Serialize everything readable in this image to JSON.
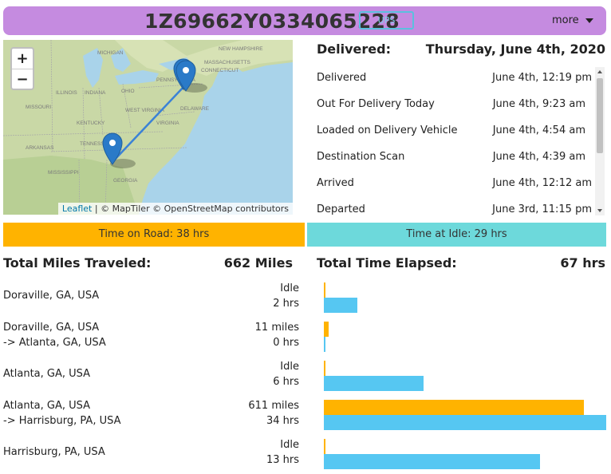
{
  "header": {
    "tracking_number": "1Z69662Y0334065228",
    "carrier": "UPS",
    "more_label": "more"
  },
  "map": {
    "zoom_in": "+",
    "zoom_out": "−",
    "attribution_leaflet": "Leaflet",
    "attribution_sep": "|",
    "attribution_rest": "© MapTiler © OpenStreetMap contributors",
    "labels": [
      "MASSACHUSETTS",
      "NEW HAMPSHIRE",
      "PENNSYLVANIA",
      "CONNECTICUT",
      "MICHIGAN",
      "ILLINOIS",
      "INDIANA",
      "OHIO",
      "MISSOURI",
      "WEST VIRGINIA",
      "VIRGINIA",
      "DELAWARE",
      "KENTUCKY",
      "ARKANSAS",
      "TENNESSEE",
      "MISSISSIPPI",
      "GEORGIA"
    ]
  },
  "events": {
    "status_label": "Delivered:",
    "status_date": "Thursday, June 4th, 2020",
    "items": [
      {
        "event": "Delivered",
        "time": "June 4th, 12:19 pm"
      },
      {
        "event": "Out For Delivery Today",
        "time": "June 4th, 9:23 am"
      },
      {
        "event": "Loaded on Delivery Vehicle",
        "time": "June 4th, 4:54 am"
      },
      {
        "event": "Destination Scan",
        "time": "June 4th, 4:39 am"
      },
      {
        "event": "Arrived",
        "time": "June 4th, 12:12 am"
      },
      {
        "event": "Departed",
        "time": "June 3rd, 11:15 pm"
      }
    ]
  },
  "time_bars": {
    "road": "Time on Road: 38 hrs",
    "idle": "Time at Idle: 29 hrs"
  },
  "summary": {
    "miles_label": "Total Miles Traveled:",
    "miles_value": "662 Miles",
    "time_label": "Total Time Elapsed:",
    "time_value": "67 hrs"
  },
  "legs": [
    {
      "from": "Doraville, GA, USA",
      "to": "",
      "miles": "Idle",
      "hrs": "2 hrs",
      "miles_frac": 0.006,
      "hrs_frac": 0.118
    },
    {
      "from": "Doraville, GA, USA",
      "to": "-> Atlanta, GA, USA",
      "miles": "11 miles",
      "hrs": "0 hrs",
      "miles_frac": 0.016,
      "hrs_frac": 0.006
    },
    {
      "from": "Atlanta, GA, USA",
      "to": "",
      "miles": "Idle",
      "hrs": "6 hrs",
      "miles_frac": 0.006,
      "hrs_frac": 0.353
    },
    {
      "from": "Atlanta, GA, USA",
      "to": "-> Harrisburg, PA, USA",
      "miles": "611 miles",
      "hrs": "34 hrs",
      "miles_frac": 0.92,
      "hrs_frac": 1.0
    },
    {
      "from": "Harrisburg, PA, USA",
      "to": "",
      "miles": "Idle",
      "hrs": "13 hrs",
      "miles_frac": 0.006,
      "hrs_frac": 0.765
    }
  ],
  "colors": {
    "header": "#c58be0",
    "road": "#ffb300",
    "idle": "#6dd9db",
    "hours_bar": "#56c7f2",
    "route": "#3b82d6",
    "marker": "#2a7ac8"
  }
}
